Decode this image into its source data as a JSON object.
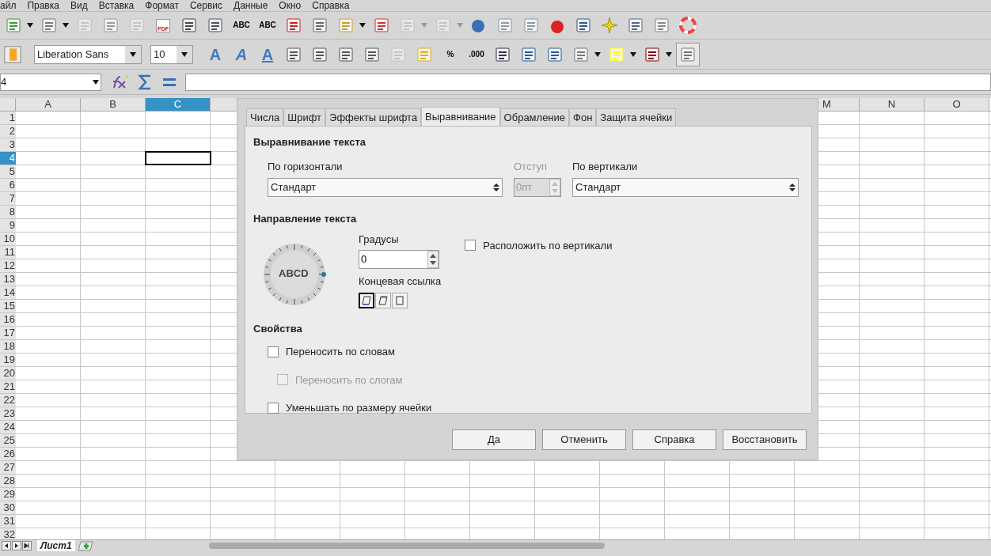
{
  "menu": [
    "айл",
    "Правка",
    "Вид",
    "Вставка",
    "Формат",
    "Сервис",
    "Данные",
    "Окно",
    "Справка"
  ],
  "toolbar_standard": [
    {
      "disabled": false,
      "dropdown": true
    },
    {
      "disabled": false,
      "dropdown": true
    },
    {
      "disabled": true,
      "dropdown": false
    },
    {
      "disabled": false,
      "dropdown": false
    },
    {
      "disabled": true,
      "dropdown": false
    },
    {
      "disabled": false,
      "dropdown": false,
      "label": "PDF"
    },
    {
      "disabled": false,
      "dropdown": false
    },
    {
      "disabled": false,
      "dropdown": false
    },
    {
      "disabled": false,
      "dropdown": false,
      "label": "ABC"
    },
    {
      "disabled": false,
      "dropdown": false,
      "label": "ABC"
    },
    {
      "disabled": false,
      "dropdown": false
    },
    {
      "disabled": false,
      "dropdown": false
    },
    {
      "disabled": false,
      "dropdown": true
    },
    {
      "disabled": false,
      "dropdown": false
    },
    {
      "disabled": true,
      "dropdown": true
    },
    {
      "disabled": true,
      "dropdown": true
    },
    {
      "disabled": false,
      "dropdown": false
    },
    {
      "disabled": false,
      "dropdown": false
    },
    {
      "disabled": false,
      "dropdown": false
    },
    {
      "disabled": false,
      "dropdown": false
    },
    {
      "disabled": false,
      "dropdown": false
    },
    {
      "disabled": false,
      "dropdown": false
    },
    {
      "disabled": false,
      "dropdown": false
    },
    {
      "disabled": false,
      "dropdown": false
    },
    {
      "disabled": false,
      "dropdown": false
    }
  ],
  "font_name": "Liberation Sans",
  "font_size": "10",
  "toolbar_format": [
    {
      "disabled": false,
      "dropdown": false,
      "label": "A"
    },
    {
      "disabled": false,
      "dropdown": false,
      "label": "A"
    },
    {
      "disabled": false,
      "dropdown": false,
      "label": "A"
    },
    {
      "disabled": false,
      "dropdown": false
    },
    {
      "disabled": false,
      "dropdown": false
    },
    {
      "disabled": false,
      "dropdown": false
    },
    {
      "disabled": false,
      "dropdown": false
    },
    {
      "disabled": true,
      "dropdown": false
    },
    {
      "disabled": false,
      "dropdown": false
    },
    {
      "disabled": false,
      "dropdown": false,
      "label": "%"
    },
    {
      "disabled": false,
      "dropdown": false,
      "label": ".000"
    },
    {
      "disabled": false,
      "dropdown": false
    },
    {
      "disabled": false,
      "dropdown": false
    },
    {
      "disabled": false,
      "dropdown": false
    },
    {
      "disabled": false,
      "dropdown": true
    },
    {
      "disabled": false,
      "dropdown": true
    },
    {
      "disabled": false,
      "dropdown": true
    },
    {
      "disabled": false,
      "dropdown": false,
      "pressed": true
    }
  ],
  "name_box": "4",
  "columns_left": [
    {
      "label": "A",
      "selected": false
    },
    {
      "label": "B",
      "selected": false
    },
    {
      "label": "C",
      "selected": true
    }
  ],
  "columns_right": [
    {
      "label": "M",
      "selected": false
    },
    {
      "label": "N",
      "selected": false
    },
    {
      "label": "O",
      "selected": false
    }
  ],
  "rows": [
    {
      "label": "1",
      "selected": false
    },
    {
      "label": "2",
      "selected": false
    },
    {
      "label": "3",
      "selected": false
    },
    {
      "label": "4",
      "selected": true
    },
    {
      "label": "5",
      "selected": false
    },
    {
      "label": "6",
      "selected": false
    },
    {
      "label": "7",
      "selected": false
    },
    {
      "label": "8",
      "selected": false
    },
    {
      "label": "9",
      "selected": false
    },
    {
      "label": "10",
      "selected": false
    },
    {
      "label": "11",
      "selected": false
    },
    {
      "label": "12",
      "selected": false
    },
    {
      "label": "13",
      "selected": false
    },
    {
      "label": "14",
      "selected": false
    },
    {
      "label": "15",
      "selected": false
    },
    {
      "label": "16",
      "selected": false
    },
    {
      "label": "17",
      "selected": false
    },
    {
      "label": "18",
      "selected": false
    },
    {
      "label": "19",
      "selected": false
    },
    {
      "label": "20",
      "selected": false
    },
    {
      "label": "21",
      "selected": false
    },
    {
      "label": "22",
      "selected": false
    },
    {
      "label": "23",
      "selected": false
    },
    {
      "label": "24",
      "selected": false
    },
    {
      "label": "25",
      "selected": false
    },
    {
      "label": "26",
      "selected": false
    },
    {
      "label": "27",
      "selected": false
    },
    {
      "label": "28",
      "selected": false
    },
    {
      "label": "29",
      "selected": false
    },
    {
      "label": "30",
      "selected": false
    },
    {
      "label": "31",
      "selected": false
    },
    {
      "label": "32",
      "selected": false
    }
  ],
  "dialog": {
    "tabs": [
      {
        "label": "Числа",
        "selected": false
      },
      {
        "label": "Шрифт",
        "selected": false
      },
      {
        "label": "Эффекты шрифта",
        "selected": false
      },
      {
        "label": "Выравнивание",
        "selected": true
      },
      {
        "label": "Обрамление",
        "selected": false
      },
      {
        "label": "Фон",
        "selected": false
      },
      {
        "label": "Защита ячейки",
        "selected": false
      }
    ],
    "alignment_title": "Выравнивание текста",
    "horizontal": {
      "label": "По горизонтали",
      "value": "Стандарт"
    },
    "indent": {
      "label": "Отступ",
      "value": "0пт",
      "disabled": true
    },
    "vertical": {
      "label": "По вертикали",
      "value": "Стандарт"
    },
    "direction_title": "Направление текста",
    "dial_text": "ABCD",
    "degrees": {
      "label": "Градусы",
      "value": "0"
    },
    "reference_edge": {
      "label": "Концевая ссылка",
      "options": [
        {
          "selected": true
        },
        {
          "selected": false
        },
        {
          "selected": false
        }
      ]
    },
    "stacked": {
      "label": "Расположить по вертикали",
      "checked": false,
      "disabled": false
    },
    "properties_title": "Свойства",
    "properties": [
      {
        "label": "Переносить по словам",
        "checked": false,
        "disabled": false,
        "indented": false
      },
      {
        "label": "Переносить по слогам",
        "checked": false,
        "disabled": true,
        "indented": true
      },
      {
        "label": "Уменьшать по размеру ячейки",
        "checked": false,
        "disabled": false,
        "indented": false
      }
    ],
    "buttons": [
      "Да",
      "Отменить",
      "Справка",
      "Восстановить"
    ]
  },
  "sheet_tabs": [
    {
      "label": "Лист1",
      "selected": true
    }
  ]
}
